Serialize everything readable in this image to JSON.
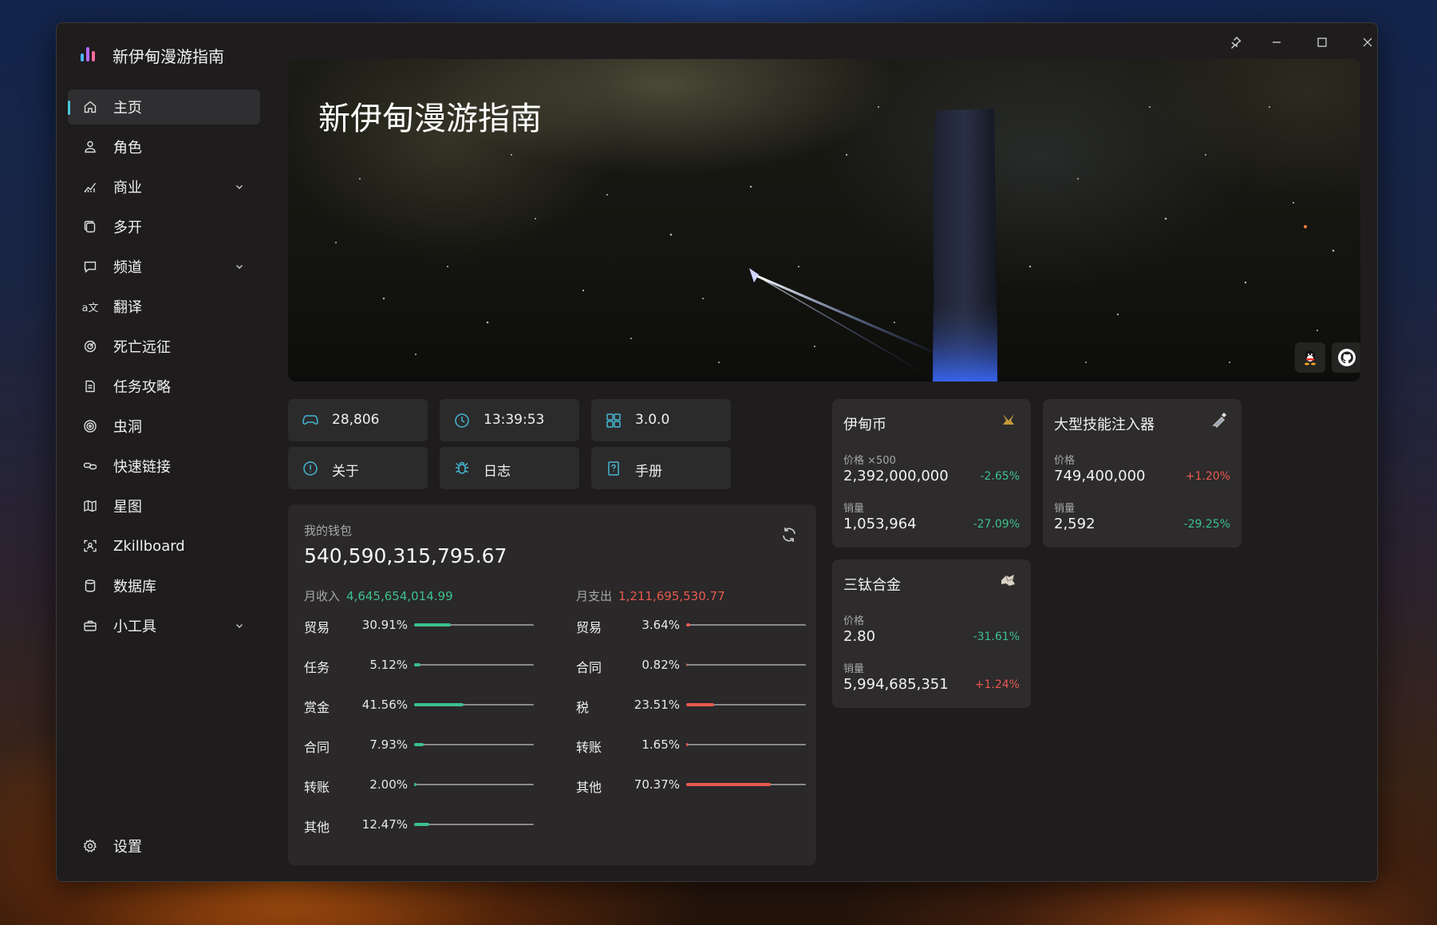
{
  "app": {
    "title": "新伊甸漫游指南"
  },
  "window_controls": {
    "pin": "pin-icon",
    "minimize": "minimize-icon",
    "maximize": "maximize-icon",
    "close": "close-icon"
  },
  "nav": {
    "items": [
      {
        "label": "主页",
        "icon": "home-icon",
        "active": true,
        "expandable": false
      },
      {
        "label": "角色",
        "icon": "person-icon",
        "expandable": false
      },
      {
        "label": "商业",
        "icon": "chart-icon",
        "expandable": true
      },
      {
        "label": "多开",
        "icon": "copy-icon",
        "expandable": false
      },
      {
        "label": "频道",
        "icon": "chat-icon",
        "expandable": true
      },
      {
        "label": "翻译",
        "icon": "translate-icon",
        "expandable": false
      },
      {
        "label": "死亡远征",
        "icon": "radar-icon",
        "expandable": false
      },
      {
        "label": "任务攻略",
        "icon": "document-icon",
        "expandable": false
      },
      {
        "label": "虫洞",
        "icon": "wormhole-icon",
        "expandable": false
      },
      {
        "label": "快速链接",
        "icon": "link-icon",
        "expandable": false
      },
      {
        "label": "星图",
        "icon": "map-icon",
        "expandable": false
      },
      {
        "label": "Zkillboard",
        "icon": "scan-icon",
        "expandable": false
      },
      {
        "label": "数据库",
        "icon": "database-icon",
        "expandable": false
      },
      {
        "label": "小工具",
        "icon": "toolbox-icon",
        "expandable": true
      }
    ],
    "settings_label": "设置"
  },
  "hero": {
    "title": "新伊甸漫游指南",
    "buttons": [
      "qq-icon",
      "github-icon"
    ]
  },
  "quick": {
    "players": "28,806",
    "server_time": "13:39:53",
    "version": "3.0.0",
    "about": "关于",
    "log": "日志",
    "manual": "手册"
  },
  "wallet": {
    "label": "我的钱包",
    "total": "540,590,315,795.67",
    "income_label": "月收入",
    "income_value": "4,645,654,014.99",
    "expense_label": "月支出",
    "expense_value": "1,211,695,530.77",
    "income_color": "#3cc08e",
    "expense_color": "#e85a4f",
    "income_rows": [
      {
        "label": "贸易",
        "percent": "30.91%",
        "fraction": 0.3091
      },
      {
        "label": "任务",
        "percent": "5.12%",
        "fraction": 0.0512
      },
      {
        "label": "赏金",
        "percent": "41.56%",
        "fraction": 0.4156
      },
      {
        "label": "合同",
        "percent": "7.93%",
        "fraction": 0.0793
      },
      {
        "label": "转账",
        "percent": "2.00%",
        "fraction": 0.02
      },
      {
        "label": "其他",
        "percent": "12.47%",
        "fraction": 0.1247
      }
    ],
    "expense_rows": [
      {
        "label": "贸易",
        "percent": "3.64%",
        "fraction": 0.0364
      },
      {
        "label": "合同",
        "percent": "0.82%",
        "fraction": 0.0082
      },
      {
        "label": "税",
        "percent": "23.51%",
        "fraction": 0.2351
      },
      {
        "label": "转账",
        "percent": "1.65%",
        "fraction": 0.0165
      },
      {
        "label": "其他",
        "percent": "70.37%",
        "fraction": 0.7037
      }
    ]
  },
  "market": [
    {
      "name": "伊甸币",
      "icon": "plex-icon",
      "price_label": "价格 ×500",
      "price": "2,392,000,000",
      "price_change": "-2.65%",
      "price_dir": "down",
      "volume_label": "销量",
      "volume": "1,053,964",
      "volume_change": "-27.09%",
      "volume_dir": "down"
    },
    {
      "name": "大型技能注入器",
      "icon": "injector-icon",
      "price_label": "价格",
      "price": "749,400,000",
      "price_change": "+1.20%",
      "price_dir": "up",
      "volume_label": "销量",
      "volume": "2,592",
      "volume_change": "-29.25%",
      "volume_dir": "down"
    },
    {
      "name": "三钛合金",
      "icon": "tritanium-icon",
      "price_label": "价格",
      "price": "2.80",
      "price_change": "-31.61%",
      "price_dir": "down",
      "volume_label": "销量",
      "volume": "5,994,685,351",
      "volume_change": "+1.24%",
      "volume_dir": "up"
    }
  ]
}
